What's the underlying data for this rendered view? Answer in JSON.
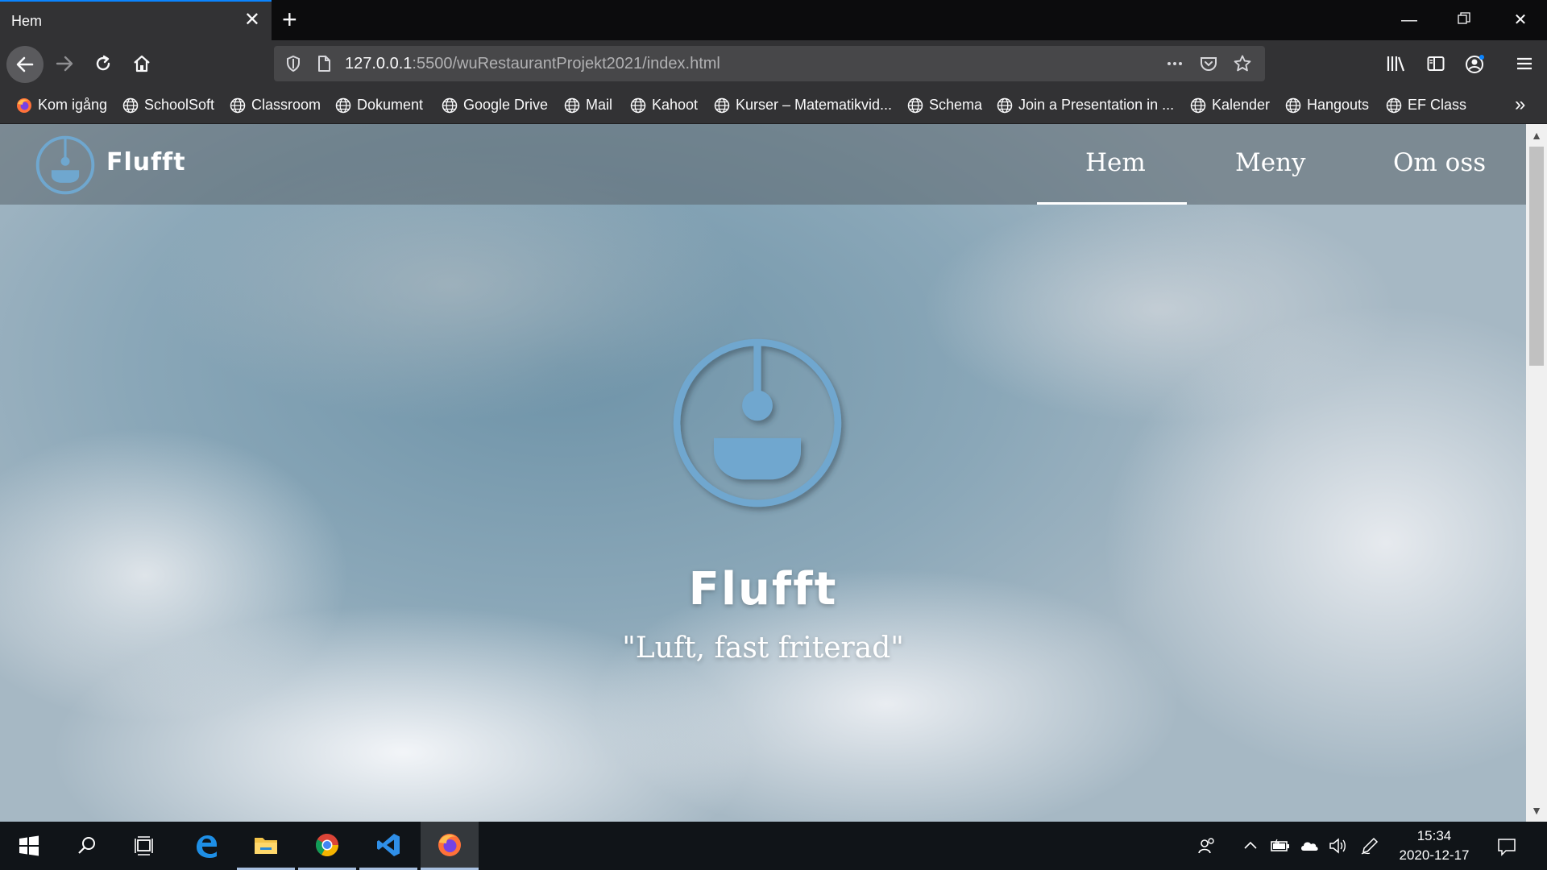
{
  "browser": {
    "tab_title": "Hem",
    "url_host": "127.0.0.1",
    "url_path": ":5500/wuRestaurantProjekt2021/index.html",
    "bookmarks": [
      {
        "label": "Kom igång",
        "icon": "firefox-icon"
      },
      {
        "label": "SchoolSoft",
        "icon": "globe-icon"
      },
      {
        "label": "Classroom",
        "icon": "globe-icon"
      },
      {
        "label": "Dokument",
        "icon": "globe-icon"
      },
      {
        "label": "Google Drive",
        "icon": "globe-icon"
      },
      {
        "label": "Mail",
        "icon": "globe-icon"
      },
      {
        "label": "Kahoot",
        "icon": "globe-icon"
      },
      {
        "label": "Kurser – Matematikvid...",
        "icon": "globe-icon"
      },
      {
        "label": "Schema",
        "icon": "globe-icon"
      },
      {
        "label": "Join a Presentation in ...",
        "icon": "globe-icon"
      },
      {
        "label": "Kalender",
        "icon": "globe-icon"
      },
      {
        "label": "Hangouts",
        "icon": "globe-icon"
      },
      {
        "label": "EF Class",
        "icon": "globe-icon"
      }
    ]
  },
  "site": {
    "logo_text": "Flufft",
    "nav": [
      {
        "label": "Hem",
        "active": true
      },
      {
        "label": "Meny",
        "active": false
      },
      {
        "label": "Om oss",
        "active": false
      }
    ],
    "hero_title": "Flufft",
    "hero_tagline": "\"Luft, fast friterad\"",
    "accent_color": "#6fa7cf"
  },
  "taskbar": {
    "time": "15:34",
    "date": "2020-12-17",
    "apps": [
      "start-icon",
      "search-icon",
      "task-view-icon",
      "edge-icon",
      "file-explorer-icon",
      "chrome-icon",
      "vscode-icon",
      "firefox-icon"
    ]
  }
}
